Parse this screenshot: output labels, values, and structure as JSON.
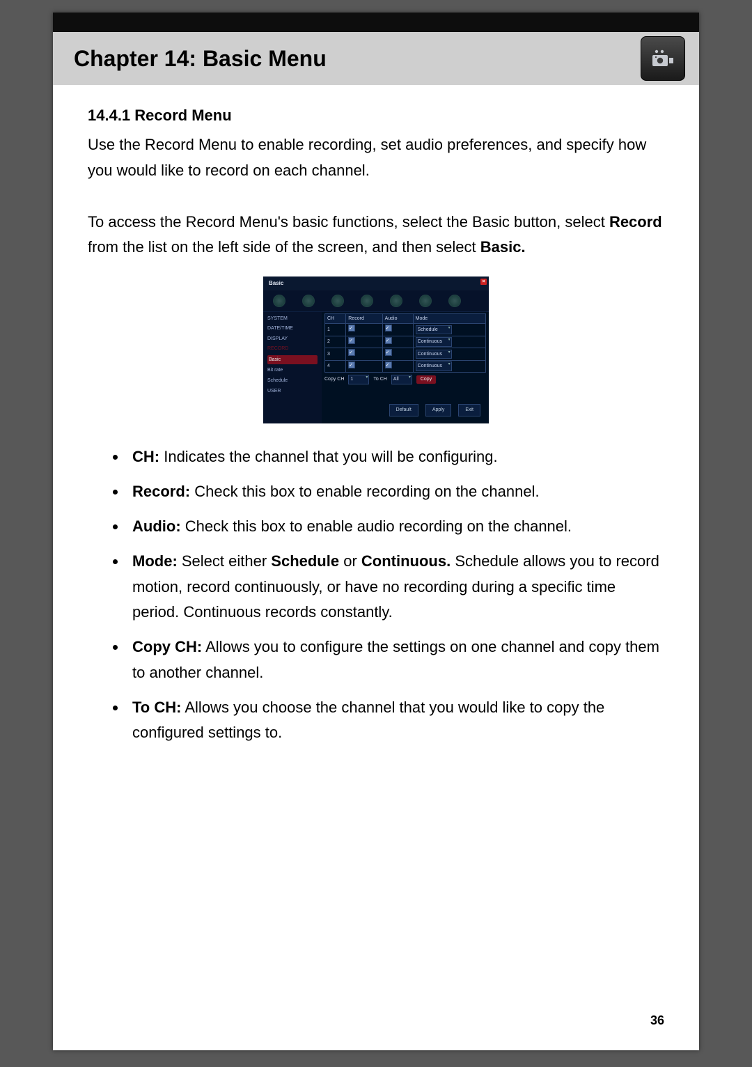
{
  "header": {
    "chapter_title": "Chapter 14: Basic Menu",
    "icon": "camera-icon"
  },
  "section": {
    "number_title": "14.4.1 Record Menu",
    "p1": "Use the Record Menu to enable recording, set audio preferences, and specify how you would like to record on each channel.",
    "p2_pre": "To access the Record Menu",
    "p2_black": "'s basic functions",
    "p2_mid": ", select the Basic button, select ",
    "p2_bold1": "Record",
    "p2_post": " from the list on the left side of the screen, and then select ",
    "p2_bold2": "Basic."
  },
  "screenshot": {
    "title": "Basic",
    "sidebar": [
      "SYSTEM",
      "DATE/TIME",
      "DISPLAY",
      "RECORD",
      "Basic",
      "Bit rate",
      "Schedule",
      "USER"
    ],
    "cols": [
      "CH",
      "Record",
      "Audio",
      "Mode"
    ],
    "rows": [
      {
        "ch": "1",
        "mode": "Schedule"
      },
      {
        "ch": "2",
        "mode": "Continuous"
      },
      {
        "ch": "3",
        "mode": "Continuous"
      },
      {
        "ch": "4",
        "mode": "Continuous"
      }
    ],
    "copy_label": "Copy CH",
    "copy_from": "1",
    "to_label": "To CH",
    "to_val": "All",
    "copy_btn": "Copy",
    "footer": [
      "Default",
      "Apply",
      "Exit"
    ]
  },
  "bullets": [
    {
      "term": "CH:",
      "text": " Indicates the channel that you will be configuring."
    },
    {
      "term": "Record:",
      "text": " Check this box to enable recording on the channel."
    },
    {
      "term": "Audio:",
      "text": " Check this box to enable audio recording on the channel."
    },
    {
      "term": "Mode:",
      "text_pre": " Select either ",
      "b1": "Schedule",
      "mid": " or ",
      "b2": "Continuous.",
      "text_post": " Schedule allows you to record motion, record continuously, or have no recording during a specific time period. Continuous records constantly."
    },
    {
      "term": "Copy CH:",
      "text": " Allows you to configure the settings on one channel and copy them to another channel."
    },
    {
      "term": "To CH:",
      "text": " Allows you choose the channel that you would like to copy the configured settings to."
    }
  ],
  "page_number": "36"
}
